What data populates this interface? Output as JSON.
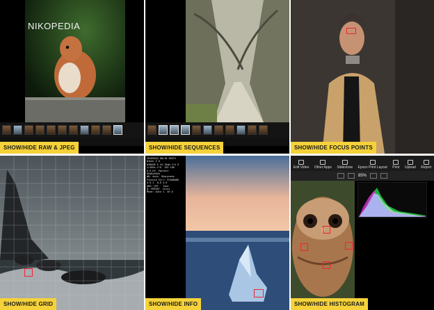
{
  "captions": {
    "raw_jpeg": "SHOW/HIDE RAW & JPEG",
    "sequences": "SHOW/HIDE SEQUENCES",
    "focus_points": "SHOW/HIDE FOCUS POINTS",
    "grid": "SHOW/HIDE GRID",
    "info": "SHOW/HIDE INFO",
    "histogram": "SHOW/HIDE HISTOGRAM"
  },
  "watermark": "NIKOPEDIA",
  "toolbar": {
    "items": [
      "Edit Video",
      "Other Apps",
      "Slideshow",
      "Epson Print Layout",
      "Print",
      "Upload",
      "Report"
    ]
  },
  "zoom": {
    "level": "85%"
  },
  "info_overlay": {
    "text": "20190922 HALIN 00271\nNikon Z 6\nNIKKOR Z 24-70mm f/4 S\n1/400s f/8  ISO 100\n0.0 EV  Pattern\n6048x4024\nWB: Auto  Sharpness\nPicture Ctrl: STANDARD\n4:3 1  A-D 4:3\nHDR: OFF   Tone\nQ: PRESET  Color\nMode: Auto 1  AF-S"
  },
  "colors": {
    "caption_bg": "#f5d23a",
    "focus_point": "#e23333"
  }
}
